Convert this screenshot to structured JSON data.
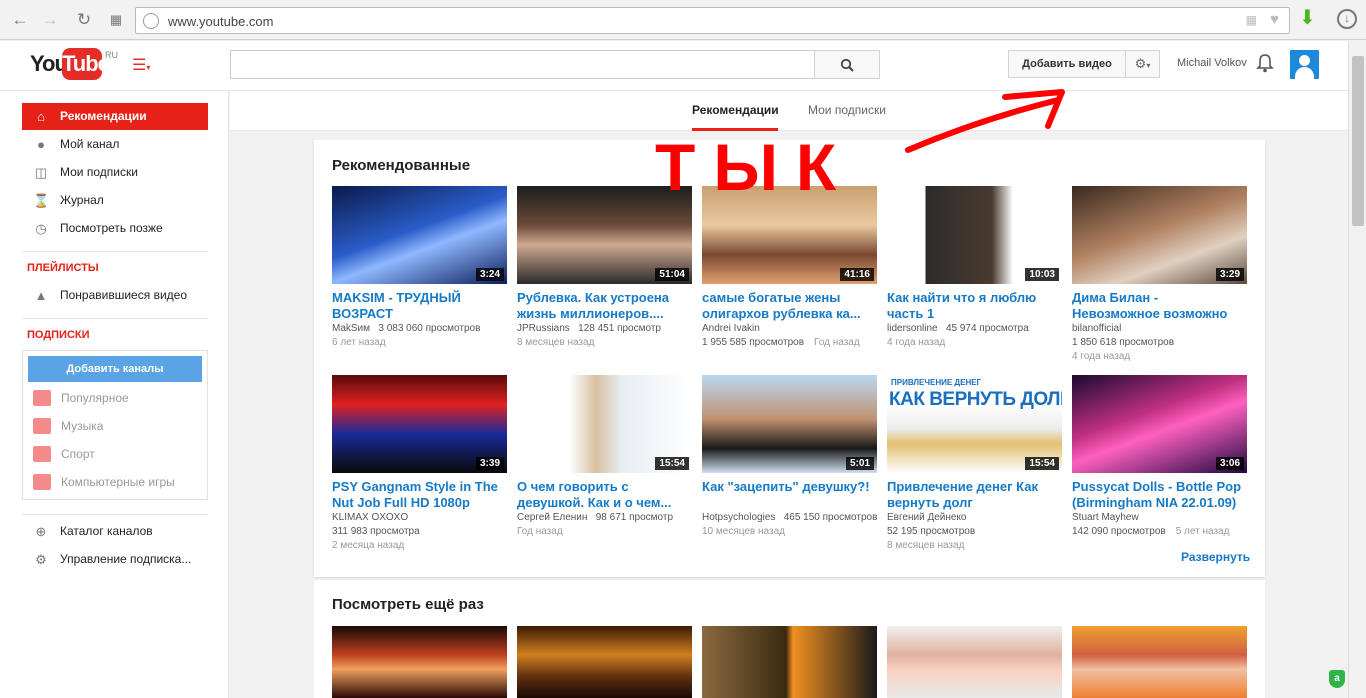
{
  "browser": {
    "url": "www.youtube.com"
  },
  "header": {
    "logo_you": "You",
    "logo_tube": "Tube",
    "logo_region": "RU",
    "upload_label": "Добавить видео",
    "user_name": "Michail Volkov"
  },
  "sidebar": {
    "items": [
      {
        "label": "Рекомендации",
        "icon": "home-icon"
      },
      {
        "label": "Мой канал",
        "icon": "user-circle-icon"
      },
      {
        "label": "Мои подписки",
        "icon": "subscriptions-icon"
      },
      {
        "label": "Журнал",
        "icon": "hourglass-icon"
      },
      {
        "label": "Посмотреть позже",
        "icon": "clock-icon"
      }
    ],
    "playlists_heading": "ПЛЕЙЛИСТЫ",
    "liked_label": "Понравившиеся видео",
    "subscriptions_heading": "ПОДПИСКИ",
    "add_channels_label": "Добавить каналы",
    "sub_suggestions": [
      "Популярное",
      "Музыка",
      "Спорт",
      "Компьютерные игры"
    ],
    "catalog_label": "Каталог каналов",
    "manage_label": "Управление подписка..."
  },
  "tabs": {
    "recommended": "Рекомендации",
    "subscriptions": "Мои подписки"
  },
  "annotation": {
    "text": "ТЫК",
    "color": "#ff0000"
  },
  "section_recommended": {
    "title": "Рекомендованные",
    "expand_label": "Развернуть",
    "videos": [
      {
        "title": "MAKSIM - ТРУДНЫЙ ВОЗРАСТ",
        "channel": "MakSим",
        "views": "3 083 060 просмотров",
        "age": "6 лет назад",
        "duration": "3:24"
      },
      {
        "title": "Рублевка. Как устроена жизнь миллионеров....",
        "channel": "JPRussians",
        "views": "128 451 просмотр",
        "age": "8 месяцев назад",
        "duration": "51:04"
      },
      {
        "title": "самые богатые жены олигархов рублевка ка...",
        "channel": "Andrei Ivakin",
        "views": "1 955 585 просмотров",
        "age": "Год назад",
        "duration": "41:16"
      },
      {
        "title": "Как найти что я люблю часть 1",
        "channel": "lidersonline",
        "views": "45 974 просмотра",
        "age": "4 года назад",
        "duration": "10:03"
      },
      {
        "title": "Дима Билан - Невозможное возможно",
        "channel": "bilanofficial",
        "views": "1 850 618 просмотров",
        "age": "4 года назад",
        "duration": "3:29"
      },
      {
        "title": "PSY Gangnam Style in The Nut Job Full HD 1080p",
        "channel": "KLIMAX OXOXO",
        "views": "311 983 просмотра",
        "age": "2 месяца назад",
        "duration": "3:39"
      },
      {
        "title": "О чем говорить с девушкой. Как и о чем...",
        "channel": "Сергей Еленин",
        "views": "98 671 просмотр",
        "age": "Год назад",
        "duration": "15:54"
      },
      {
        "title": "Как \"зацепить\" девушку?!",
        "channel": "Hotpsychologies",
        "views": "465 150 просмотров",
        "age": "10 месяцев назад",
        "duration": "5:01"
      },
      {
        "title": "Привлечение денег Как вернуть долг",
        "channel": "Евгений Дейнеко",
        "views": "52 195 просмотров",
        "age": "8 месяцев назад",
        "duration": "15:54"
      },
      {
        "title": "Pussycat Dolls - Bottle Pop (Birmingham NIA 22.01.09)",
        "channel": "Stuart Mayhew",
        "views": "142 090 просмотров",
        "age": "5 лет назад",
        "duration": "3:06"
      }
    ]
  },
  "thumb_texts": {
    "debt_small": "ПРИВЛЕЧЕНИЕ ДЕНЕГ",
    "debt_big": "КАК ВЕРНУТЬ ДОЛГ"
  },
  "section_rewatch": {
    "title": "Посмотреть ещё раз"
  }
}
